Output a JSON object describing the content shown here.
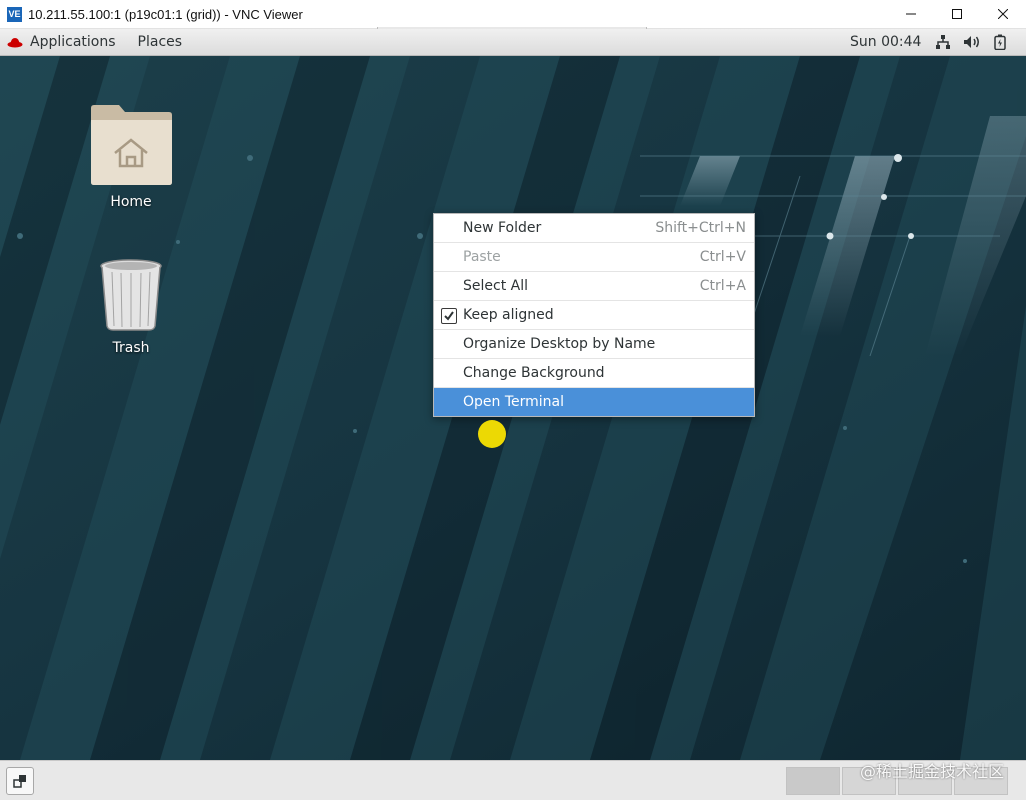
{
  "window": {
    "title": "10.211.55.100:1 (p19c01:1 (grid)) - VNC Viewer",
    "logo_text": "VE",
    "controls": [
      "minimize-icon",
      "maximize-icon",
      "close-icon"
    ]
  },
  "topbar": {
    "applications_label": "Applications",
    "places_label": "Places",
    "clock": "Sun 00:44",
    "tray_icons": [
      "network-icon",
      "volume-icon",
      "battery-icon"
    ]
  },
  "desktop": {
    "icons": [
      {
        "label": "Home",
        "icon": "home-folder-icon"
      },
      {
        "label": "Trash",
        "icon": "trash-icon"
      }
    ]
  },
  "context_menu": {
    "items": [
      {
        "label": "New Folder",
        "accel": "Shift+Ctrl+N",
        "enabled": true
      },
      {
        "label": "Paste",
        "accel": "Ctrl+V",
        "enabled": false
      },
      {
        "label": "Select All",
        "accel": "Ctrl+A",
        "enabled": true
      },
      {
        "label": "Keep aligned",
        "accel": "",
        "enabled": true,
        "checked": true
      },
      {
        "label": "Organize Desktop by Name",
        "accel": "",
        "enabled": true
      },
      {
        "label": "Change Background",
        "accel": "",
        "enabled": true
      },
      {
        "label": "Open Terminal",
        "accel": "",
        "enabled": true,
        "highlighted": true
      }
    ]
  },
  "bottom_bar": {
    "watermark": "@稀土掘金技术社区"
  },
  "colors": {
    "menu_highlight": "#4a90d9",
    "desktop_bg": "#15303a",
    "cursor_highlight": "#ffe800"
  }
}
